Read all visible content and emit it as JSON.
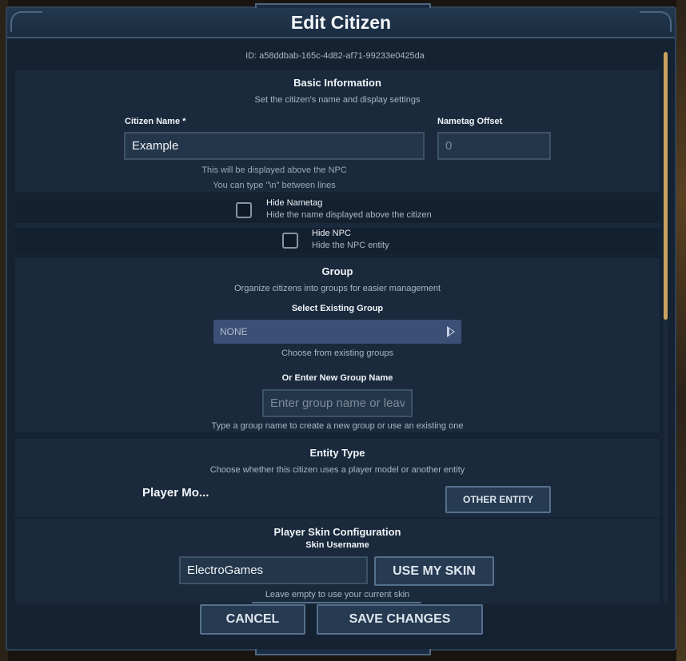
{
  "dialog": {
    "title": "Edit Citizen",
    "id_line": "ID: a58ddbab-165c-4d82-af71-99233e0425da"
  },
  "basic": {
    "title": "Basic Information",
    "desc": "Set the citizen's name and display settings",
    "name_label": "Citizen Name *",
    "name_value": "Example",
    "offset_label": "Nametag Offset",
    "offset_value": "0",
    "hint1": "This will be displayed above the NPC",
    "hint2": "You can type \"\\n\" between lines",
    "hide_nametag_label": "Hide Nametag",
    "hide_nametag_desc": "Hide the name displayed above the citizen",
    "hide_npc_label": "Hide NPC",
    "hide_npc_desc": "Hide the NPC entity"
  },
  "group": {
    "title": "Group",
    "desc": "Organize citizens into groups for easier management",
    "select_label": "Select Existing Group",
    "select_value": "NONE",
    "select_hint": "Choose from existing groups",
    "new_label": "Or Enter New Group Name",
    "new_placeholder": "Enter group name or leave empty",
    "new_hint": "Type a group name to create a new group or use an existing one"
  },
  "entity": {
    "title": "Entity Type",
    "desc": "Choose whether this citizen uses a player model or another entity",
    "player_model": "Player Mo...",
    "other_button": "OTHER ENTITY"
  },
  "skin": {
    "title": "Player Skin Configuration",
    "username_label": "Skin Username",
    "username_value": "ElectroGames",
    "use_my_skin": "USE MY SKIN",
    "hint": "Leave empty to use your current skin"
  },
  "footer": {
    "cancel": "CANCEL",
    "save": "SAVE CHANGES"
  }
}
